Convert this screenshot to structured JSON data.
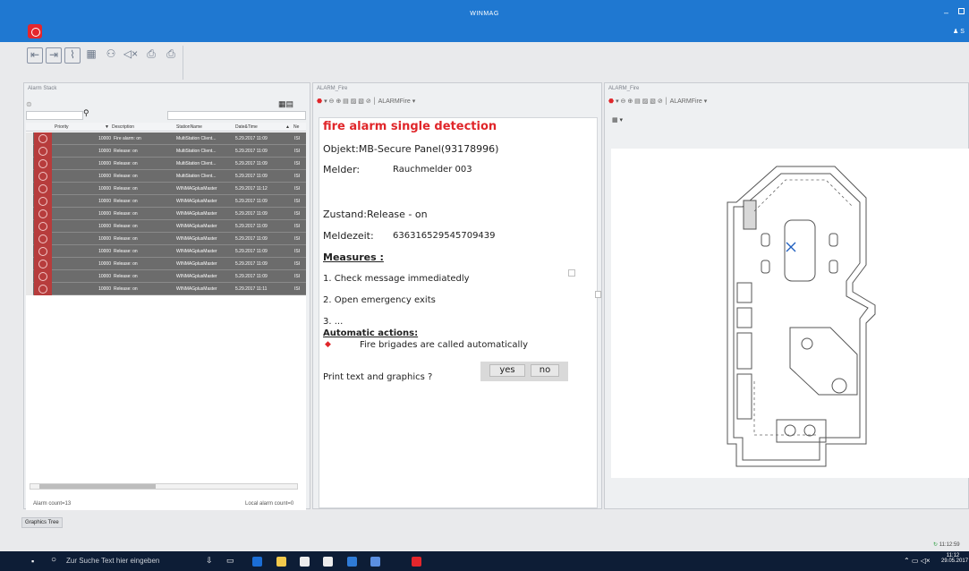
{
  "window": {
    "title": "WINMAG",
    "user": "S",
    "minimize": "–"
  },
  "toolbar": {
    "icons": [
      "back-icon",
      "forward-icon",
      "chart-icon",
      "grid-icon",
      "people-icon",
      "mute-icon",
      "print-icon",
      "print-all-icon"
    ]
  },
  "alarm_stack": {
    "title": "Alarm Stack",
    "columns": [
      "Priority",
      "Description",
      "StationName",
      "Date&Time",
      "Ne"
    ],
    "rows": [
      {
        "priority": "10000",
        "description": "Fire alarm: on",
        "station": "MultiStation Client...",
        "datetime": "5.29.2017 11:09",
        "ne": "ISI"
      },
      {
        "priority": "10000",
        "description": "Release: on",
        "station": "MultiStation Client...",
        "datetime": "5.29.2017 11:09",
        "ne": "ISI"
      },
      {
        "priority": "10000",
        "description": "Release: on",
        "station": "MultiStation Client...",
        "datetime": "5.29.2017 11:09",
        "ne": "ISI"
      },
      {
        "priority": "10000",
        "description": "Release: on",
        "station": "MultiStation Client...",
        "datetime": "5.29.2017 11:09",
        "ne": "ISI"
      },
      {
        "priority": "10000",
        "description": "Release: on",
        "station": "WINMAGplusMaster",
        "datetime": "5.29.2017 11:12",
        "ne": "ISI"
      },
      {
        "priority": "10000",
        "description": "Release: on",
        "station": "WINMAGplusMaster",
        "datetime": "5.29.2017 11:09",
        "ne": "ISI"
      },
      {
        "priority": "10000",
        "description": "Release: on",
        "station": "WINMAGplusMaster",
        "datetime": "5.29.2017 11:09",
        "ne": "ISI"
      },
      {
        "priority": "10000",
        "description": "Release: on",
        "station": "WINMAGplusMaster",
        "datetime": "5.29.2017 11:09",
        "ne": "ISI"
      },
      {
        "priority": "10000",
        "description": "Release: on",
        "station": "WINMAGplusMaster",
        "datetime": "5.29.2017 11:09",
        "ne": "ISI"
      },
      {
        "priority": "10000",
        "description": "Release: on",
        "station": "WINMAGplusMaster",
        "datetime": "5.29.2017 11:09",
        "ne": "ISI"
      },
      {
        "priority": "10000",
        "description": "Release: on",
        "station": "WINMAGplusMaster",
        "datetime": "5.29.2017 11:09",
        "ne": "ISI"
      },
      {
        "priority": "10000",
        "description": "Release: on",
        "station": "WINMAGplusMaster",
        "datetime": "5.29.2017 11:09",
        "ne": "ISI"
      },
      {
        "priority": "10000",
        "description": "Release: on",
        "station": "WINMAGplusMaster",
        "datetime": "5.29.2017 11:11",
        "ne": "ISI"
      }
    ],
    "alarm_count": "Alarm count=13",
    "local_alarm_count": "Local alarm count=0"
  },
  "alarm_fire": {
    "title": "ALARM_Fire",
    "dropdown": "ALARMFire",
    "heading": "fire alarm single detection",
    "objekt": "Objekt:MB-Secure Panel(93178996)",
    "melder_label": "Melder:",
    "melder_value": "Rauchmelder 003",
    "zustand": "Zustand:Release - on",
    "meldezeit_label": "Meldezeit:",
    "meldezeit_value": "636316529545709439",
    "measures_heading": "Measures :",
    "measure1": "1. Check message immediatedly",
    "measure2": "2. Open emergency exits",
    "measure3": "3. ...",
    "auto_heading": "Automatic actions:",
    "auto_item": "Fire brigades are called automatically",
    "print_question": "Print text and graphics ?",
    "yes": "yes",
    "no": "no"
  },
  "graphics": {
    "title": "ALARM_Fire",
    "dropdown": "ALARMFire"
  },
  "bottom": {
    "graphics_tree": "Graphics Tree",
    "clock_status": "11:12:59"
  },
  "taskbar": {
    "search_placeholder": "Zur Suche Text hier eingeben",
    "time": "11:12",
    "date": "29.05.2017"
  },
  "colors": {
    "titlebar": "#1f78d1",
    "alarm_red": "#e4262c",
    "heading_red": "#e0262a",
    "row_bg": "#6c6c6c"
  }
}
